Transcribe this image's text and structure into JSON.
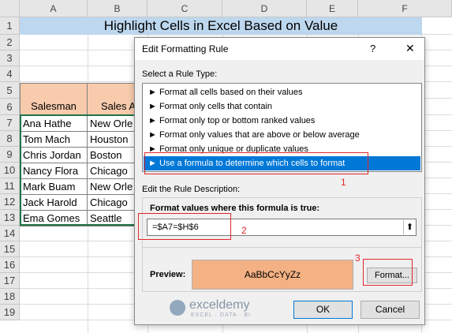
{
  "columns": [
    "A",
    "B",
    "C",
    "D",
    "E",
    "F"
  ],
  "rows": [
    "1",
    "2",
    "3",
    "4",
    "5",
    "6",
    "7",
    "8",
    "9",
    "10",
    "11",
    "12",
    "13",
    "14",
    "15",
    "16",
    "17",
    "18",
    "19"
  ],
  "sheet": {
    "title": "Highlight Cells in Excel Based on Value",
    "headers": {
      "salesman": "Salesman",
      "sales": "Sales A"
    },
    "records": [
      {
        "name": "Ana Hathe",
        "city": "New Orle"
      },
      {
        "name": "Tom Mach",
        "city": "Houston"
      },
      {
        "name": "Chris Jordan",
        "city": "Boston"
      },
      {
        "name": "Nancy Flora",
        "city": "Chicago"
      },
      {
        "name": "Mark Buam",
        "city": "New Orle"
      },
      {
        "name": "Jack Harold",
        "city": "Chicago"
      },
      {
        "name": "Ema Gomes",
        "city": "Seattle"
      }
    ]
  },
  "dialog": {
    "title": "Edit Formatting Rule",
    "help": "?",
    "close": "✕",
    "select_label": "Select a Rule Type:",
    "rule_types": [
      "► Format all cells based on their values",
      "► Format only cells that contain",
      "► Format only top or bottom ranked values",
      "► Format only values that are above or below average",
      "► Format only unique or duplicate values",
      "► Use a formula to determine which cells to format"
    ],
    "edit_label": "Edit the Rule Description:",
    "formula_label": "Format values where this formula is true:",
    "formula_value": "=$A7=$H$6",
    "preview_label": "Preview:",
    "preview_text": "AaBbCcYyZz",
    "format_button": "Format...",
    "ok_button": "OK",
    "cancel_button": "Cancel"
  },
  "annotations": [
    "1",
    "2",
    "3"
  ],
  "watermark": {
    "name": "exceldemy",
    "tagline": "EXCEL · DATA · BI"
  },
  "colors": {
    "title_fill": "#bdd7ee",
    "header_fill": "#f8cbad",
    "preview_fill": "#f4b183",
    "selection": "#0078d7",
    "annotation": "#e0262b",
    "active_green": "#217346"
  }
}
